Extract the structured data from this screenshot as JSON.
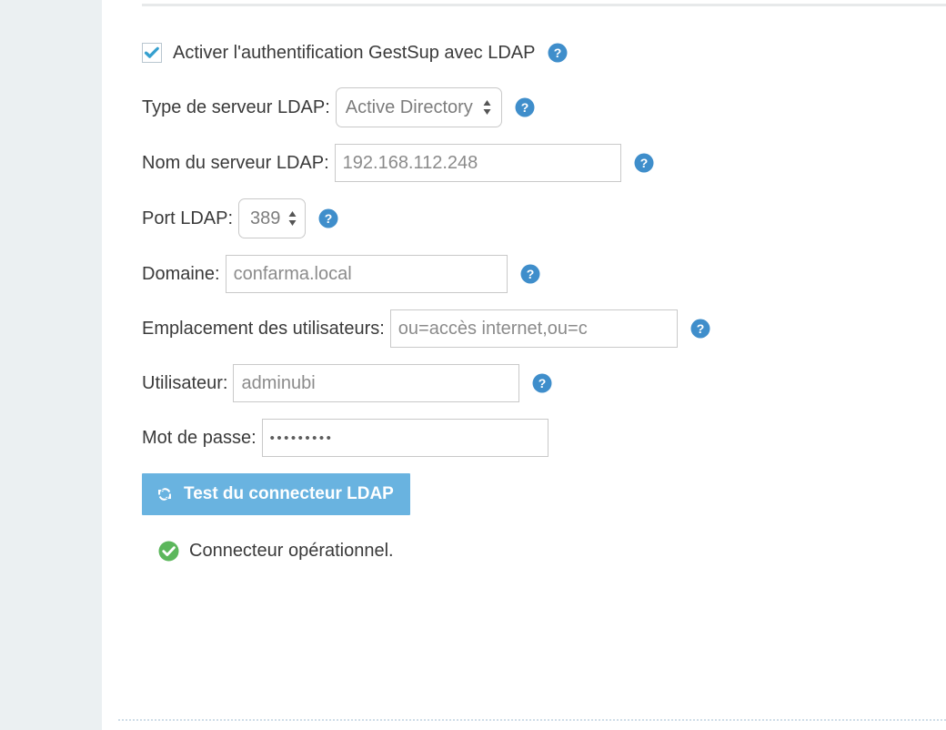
{
  "colors": {
    "sidebar_bg": "#ebf0f2",
    "content_bg": "#ffffff",
    "help_icon": "#3f8ecb",
    "checkbox_check": "#36a0cf",
    "button_bg": "#69b3e0",
    "status_ok": "#5cb75c",
    "label_text": "#3a3a3a",
    "input_text": "#8b8b8b",
    "border": "#c9c9c9"
  },
  "form": {
    "enable_ldap": {
      "label": "Activer l'authentification GestSup avec LDAP",
      "checked": true,
      "checkbox_icon": "checkmark-icon",
      "help_icon": "help-circle-icon"
    },
    "server_type": {
      "label": "Type de serveur LDAP:",
      "value": "Active Directory",
      "options": [
        "Active Directory"
      ],
      "caret_icon": "updown-caret-icon",
      "help_icon": "help-circle-icon"
    },
    "server_name": {
      "label": "Nom du serveur LDAP:",
      "value": "192.168.112.248",
      "placeholder": "192.168.112.248",
      "help_icon": "help-circle-icon"
    },
    "port": {
      "label": "Port LDAP:",
      "value": "389",
      "caret_icon": "updown-caret-icon",
      "help_icon": "help-circle-icon"
    },
    "domain": {
      "label": "Domaine:",
      "value": "confarma.local",
      "placeholder": "confarma.local",
      "help_icon": "help-circle-icon"
    },
    "users_location": {
      "label": "Emplacement des utilisateurs:",
      "value": "ou=accès internet,ou=c",
      "placeholder": "ou=accès internet,ou=c",
      "help_icon": "help-circle-icon"
    },
    "username": {
      "label": "Utilisateur:",
      "value": "adminubi",
      "placeholder": "adminubi",
      "help_icon": "help-circle-icon"
    },
    "password": {
      "label": "Mot de passe:",
      "value": "•••••••••",
      "masked": true
    },
    "test_button": {
      "label": "Test du connecteur LDAP",
      "icon": "sync-refresh-icon"
    },
    "status": {
      "text": "Connecteur opérationnel.",
      "icon": "check-circle-icon",
      "state": "success"
    }
  }
}
